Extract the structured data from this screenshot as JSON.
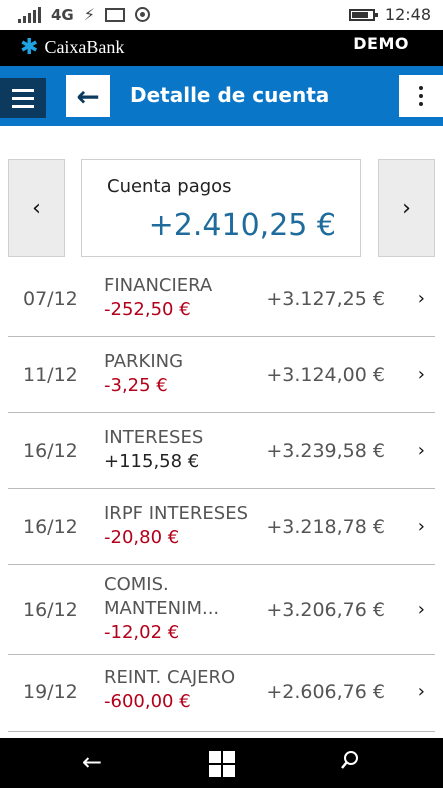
{
  "status_bar": {
    "network": "4G",
    "time": "12:48"
  },
  "brand": {
    "name": "CaixaBank",
    "mode": "DEMO"
  },
  "header": {
    "title": "Detalle de cuenta"
  },
  "account": {
    "name": "Cuenta pagos",
    "balance": "+2.410,25 €"
  },
  "transactions": [
    {
      "date": "07/12",
      "description": [
        "FINANCIERA"
      ],
      "amount": "-252,50 €",
      "negative": true,
      "balance": "+3.127,25 €"
    },
    {
      "date": "11/12",
      "description": [
        "PARKING"
      ],
      "amount": "-3,25 €",
      "negative": true,
      "balance": "+3.124,00 €"
    },
    {
      "date": "16/12",
      "description": [
        "INTERESES"
      ],
      "amount": "+115,58 €",
      "negative": false,
      "balance": "+3.239,58 €"
    },
    {
      "date": "16/12",
      "description": [
        "IRPF INTERESES"
      ],
      "amount": "-20,80 €",
      "negative": true,
      "balance": "+3.218,78 €"
    },
    {
      "date": "16/12",
      "description": [
        "COMIS.",
        "MANTENIM..."
      ],
      "amount": "-12,02 €",
      "negative": true,
      "balance": "+3.206,76 €"
    },
    {
      "date": "19/12",
      "description": [
        "REINT. CAJERO"
      ],
      "amount": "-600,00 €",
      "negative": true,
      "balance": "+2.606,76 €"
    }
  ],
  "colors": {
    "header_blue": "#0a76c7",
    "menu_dark": "#0b3a5e",
    "balance_blue": "#1e6b9c",
    "negative_red": "#b3001b"
  }
}
